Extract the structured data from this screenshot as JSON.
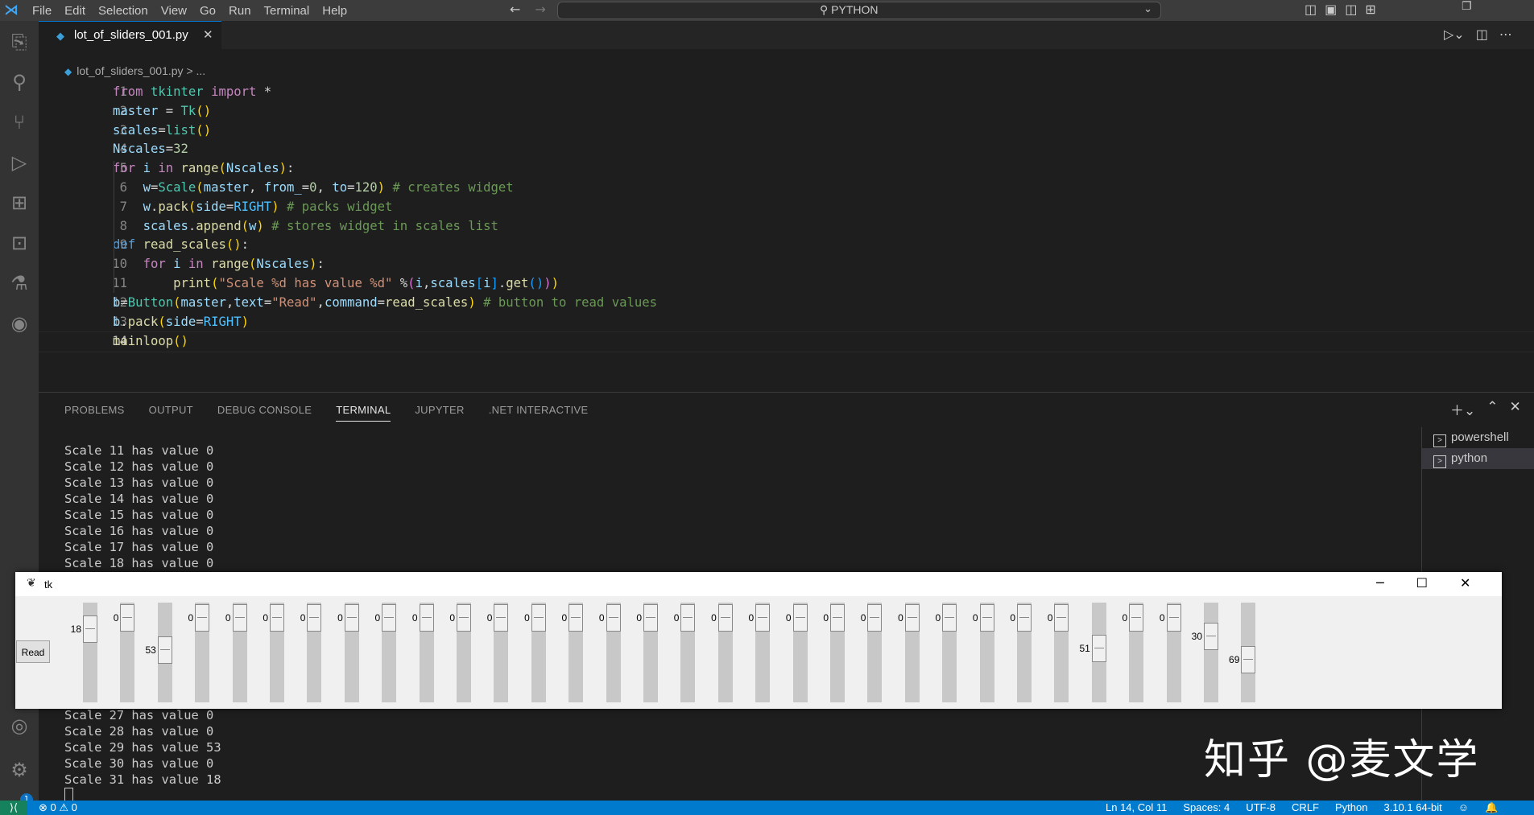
{
  "menu": [
    "File",
    "Edit",
    "Selection",
    "View",
    "Go",
    "Run",
    "Terminal",
    "Help"
  ],
  "command_center": "PYTHON",
  "tab": {
    "name": "lot_of_sliders_001.py",
    "close": "✕"
  },
  "breadcrumb": {
    "file": "lot_of_sliders_001.py",
    "sep": ">",
    "more": "..."
  },
  "code_line_numbers": [
    "1",
    "2",
    "3",
    "4",
    "5",
    "6",
    "7",
    "8",
    "9",
    "10",
    "11",
    "12",
    "13",
    "14"
  ],
  "code_text": [
    "from tkinter import *",
    "master = Tk()",
    "scales=list()",
    "Nscales=32",
    "for i in range(Nscales):",
    "    w=Scale(master, from_=0, to=120) # creates widget",
    "    w.pack(side=RIGHT) # packs widget",
    "    scales.append(w) # stores widget in scales list",
    "def read_scales():",
    "    for i in range(Nscales):",
    "        print(\"Scale %d has value %d\" %(i,scales[i].get()))",
    "b=Button(master,text=\"Read\",command=read_scales) # button to read values",
    "b.pack(side=RIGHT)",
    "mainloop()"
  ],
  "panel_tabs": [
    "PROBLEMS",
    "OUTPUT",
    "DEBUG CONSOLE",
    "TERMINAL",
    "JUPYTER",
    ".NET INTERACTIVE"
  ],
  "terminal_list": [
    "powershell",
    "python"
  ],
  "terminal_top": [
    "Scale 11 has value 0",
    "Scale 12 has value 0",
    "Scale 13 has value 0",
    "Scale 14 has value 0",
    "Scale 15 has value 0",
    "Scale 16 has value 0",
    "Scale 17 has value 0",
    "Scale 18 has value 0"
  ],
  "terminal_bottom": [
    "Scale 27 has value 0",
    "Scale 28 has value 0",
    "Scale 29 has value 53",
    "Scale 30 has value 0",
    "Scale 31 has value 18"
  ],
  "status": {
    "problems": "⊗ 0 ⚠ 0",
    "position": "Ln 14, Col 11",
    "spaces": "Spaces: 4",
    "encoding": "UTF-8",
    "eol": "CRLF",
    "language": "Python",
    "interpreter": "3.10.1 64-bit"
  },
  "accounts_badge": "1",
  "watermark": "知乎 @麦文学",
  "tk": {
    "title": "tk",
    "read_button": "Read",
    "scale_range": [
      0,
      120
    ],
    "scales": [
      {
        "value": 18,
        "label": "18"
      },
      {
        "value": 0,
        "label": "0"
      },
      {
        "value": 53,
        "label": "53"
      },
      {
        "value": 0,
        "label": "0"
      },
      {
        "value": 0,
        "label": "0"
      },
      {
        "value": 0,
        "label": "0"
      },
      {
        "value": 0,
        "label": "0"
      },
      {
        "value": 0,
        "label": "0"
      },
      {
        "value": 0,
        "label": "0"
      },
      {
        "value": 0,
        "label": "0"
      },
      {
        "value": 0,
        "label": "0"
      },
      {
        "value": 0,
        "label": "0"
      },
      {
        "value": 0,
        "label": "0"
      },
      {
        "value": 0,
        "label": "0"
      },
      {
        "value": 0,
        "label": "0"
      },
      {
        "value": 0,
        "label": "0"
      },
      {
        "value": 0,
        "label": "0"
      },
      {
        "value": 0,
        "label": "0"
      },
      {
        "value": 0,
        "label": "0"
      },
      {
        "value": 0,
        "label": "0"
      },
      {
        "value": 0,
        "label": "0"
      },
      {
        "value": 0,
        "label": "0"
      },
      {
        "value": 0,
        "label": "0"
      },
      {
        "value": 0,
        "label": "0"
      },
      {
        "value": 0,
        "label": "0"
      },
      {
        "value": 0,
        "label": "0"
      },
      {
        "value": 0,
        "label": "0"
      },
      {
        "value": 51,
        "label": "51"
      },
      {
        "value": 0,
        "label": "0"
      },
      {
        "value": 0,
        "label": "0"
      },
      {
        "value": 30,
        "label": "30"
      },
      {
        "value": 69,
        "label": "69"
      }
    ]
  },
  "icons": {
    "activity": [
      "files-icon",
      "search-icon",
      "source-control-icon",
      "run-debug-icon",
      "extensions-icon",
      "remote-explorer-icon",
      "testing-icon",
      "edge-devtools-icon",
      "accounts-icon",
      "settings-gear-icon"
    ]
  }
}
